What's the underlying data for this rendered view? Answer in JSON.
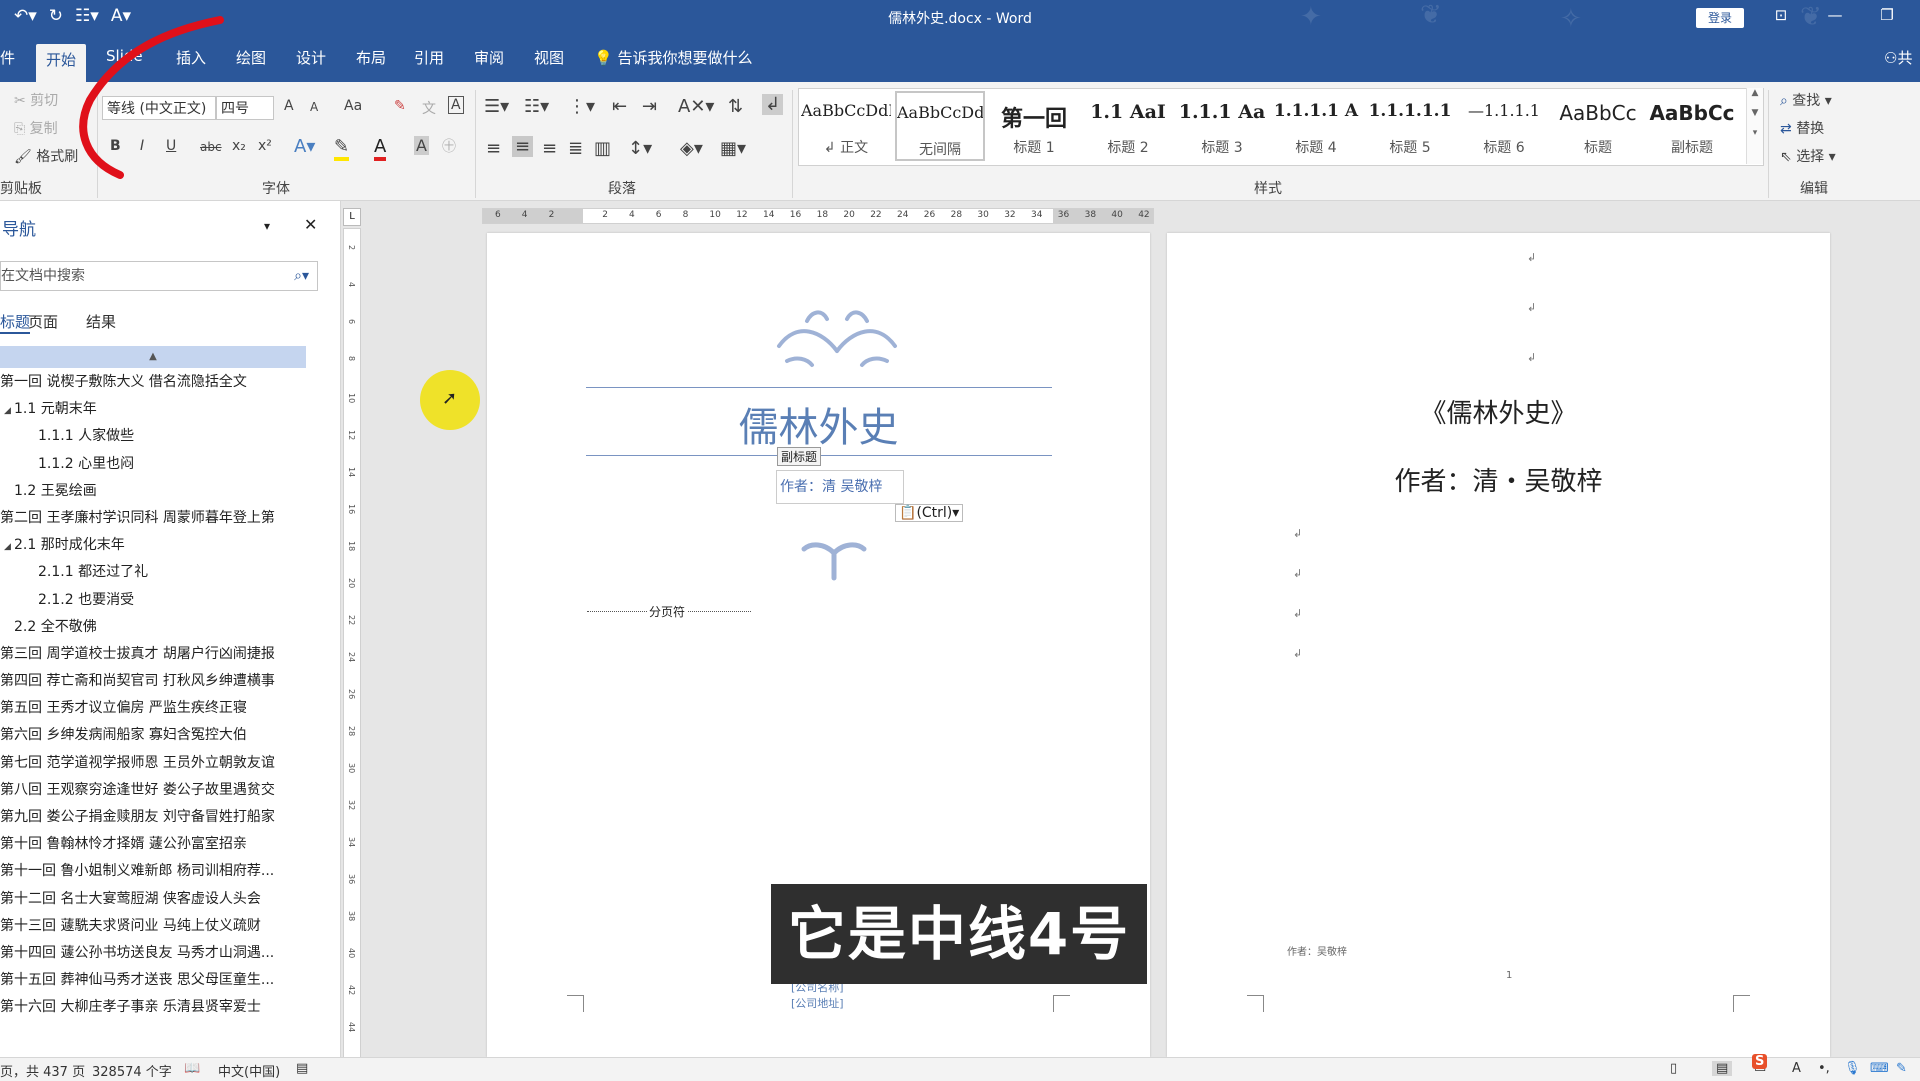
{
  "window": {
    "title": "儒林外史.docx  -  Word",
    "login_button": "登录",
    "share": "共"
  },
  "tabs": [
    "件",
    "开始",
    "Slide",
    "插入",
    "绘图",
    "设计",
    "布局",
    "引用",
    "审阅",
    "视图"
  ],
  "tell_me": "告诉我你想要做什么",
  "ribbon": {
    "clipboard": {
      "cut": "剪切",
      "copy": "复制",
      "format_painter": "格式刷",
      "label": "剪贴板"
    },
    "font": {
      "name": "等线 (中文正文)",
      "size": "四号",
      "label": "字体",
      "bold": "B",
      "italic": "I",
      "underline": "U",
      "strike": "abc",
      "sub": "x₂",
      "sup": "x²",
      "grow": "A",
      "shrink": "A",
      "case": "Aa"
    },
    "paragraph": {
      "label": "段落"
    },
    "styles": {
      "label": "样式",
      "items": [
        {
          "preview": "AaBbCcDdI",
          "name": "↲ 正文"
        },
        {
          "preview": "AaBbCcDdE",
          "name": "无间隔"
        },
        {
          "preview": "第一回",
          "name": "标题 1"
        },
        {
          "preview": "1.1 AaI",
          "name": "标题 2"
        },
        {
          "preview": "1.1.1 Aa",
          "name": "标题 3"
        },
        {
          "preview": "1.1.1.1 A",
          "name": "标题 4"
        },
        {
          "preview": "1.1.1.1.1",
          "name": "标题 5"
        },
        {
          "preview": "—1.1.1.1",
          "name": "标题 6"
        },
        {
          "preview": "AaBbCc",
          "name": "标题"
        },
        {
          "preview": "AaBbCc",
          "name": "副标题"
        }
      ]
    },
    "editing": {
      "label": "编辑",
      "find": "查找",
      "replace": "替换",
      "select": "选择"
    }
  },
  "nav": {
    "title": "导航",
    "search_placeholder": "在文档中搜索",
    "tabs": [
      "标题",
      "页面",
      "结果"
    ],
    "items": [
      {
        "text": "第一回 说楔子敷陈大义 借名流隐括全文",
        "level": 0
      },
      {
        "text": "1.1 元朝末年",
        "level": 1
      },
      {
        "text": "1.1.1 人家做些",
        "level": 2
      },
      {
        "text": "1.1.2 心里也闷",
        "level": 2
      },
      {
        "text": "1.2 王冕绘画",
        "level": 1
      },
      {
        "text": "第二回 王孝廉村学识同科 周蒙师暮年登上第",
        "level": 0
      },
      {
        "text": "2.1 那时成化末年",
        "level": 1
      },
      {
        "text": "2.1.1 都还过了礼",
        "level": 2
      },
      {
        "text": "2.1.2 也要消受",
        "level": 2
      },
      {
        "text": "2.2 全不敬佛",
        "level": 1
      },
      {
        "text": "第三回 周学道校士拔真才 胡屠户行凶闹捷报",
        "level": 0
      },
      {
        "text": "第四回 荐亡斋和尚契官司 打秋风乡绅遭横事",
        "level": 0
      },
      {
        "text": "第五回 王秀才议立偏房 严监生疾终正寝",
        "level": 0
      },
      {
        "text": "第六回 乡绅发病闹船家 寡妇含冤控大伯",
        "level": 0
      },
      {
        "text": "第七回 范学道视学报师恩 王员外立朝敦友谊",
        "level": 0
      },
      {
        "text": "第八回 王观察穷途逢世好 娄公子故里遇贫交",
        "level": 0
      },
      {
        "text": "第九回 娄公子捐金赎朋友 刘守备冒姓打船家",
        "level": 0
      },
      {
        "text": "第十回 鲁翰林怜才择婿 蘧公孙富室招亲",
        "level": 0
      },
      {
        "text": "第十一回 鲁小姐制义难新郎 杨司训相府荐...",
        "level": 0
      },
      {
        "text": "第十二回 名士大宴莺脰湖 侠客虚设人头会",
        "level": 0
      },
      {
        "text": "第十三回 蘧駪夫求贤问业 马纯上仗义疏财",
        "level": 0
      },
      {
        "text": "第十四回 蘧公孙书坊送良友 马秀才山洞遇...",
        "level": 0
      },
      {
        "text": "第十五回 葬神仙马秀才送丧 思父母匡童生...",
        "level": 0
      },
      {
        "text": "第十六回 大柳庄孝子事亲 乐清县贤宰爱士",
        "level": 0
      }
    ]
  },
  "page1": {
    "title": "儒林外史",
    "subtitle_tag": "副标题",
    "subtitle": "作者：清 吴敬梓",
    "paste_options": "(Ctrl)",
    "page_break": "分页符",
    "company_name": "[公司名称]",
    "company_address": "[公司地址]"
  },
  "page2": {
    "title": "《儒林外史》",
    "author": "作者：清・吴敬梓",
    "footer_author": "作者：吴敬梓",
    "page_number": "1"
  },
  "caption": "它是中线4号",
  "status": {
    "page": "页，共 437 页",
    "words": "328574 个字",
    "language": "中文(中国)"
  },
  "colors": {
    "accent": "#2b579a",
    "title_blue": "#5a7fb5",
    "ornament": "#9fb2d6"
  }
}
